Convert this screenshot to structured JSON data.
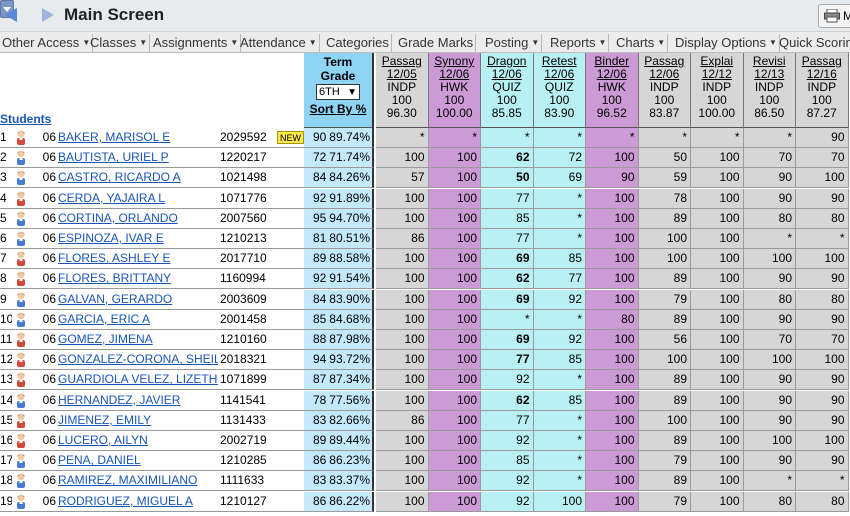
{
  "window": {
    "title": "Main Screen",
    "print_label": "M"
  },
  "menu": [
    {
      "label": "Other Access",
      "caret": true
    },
    {
      "label": "Classes",
      "caret": true
    },
    {
      "label": "Assignments",
      "caret": true
    },
    {
      "label": "Attendance",
      "caret": true
    },
    {
      "label": "Categories",
      "caret": false
    },
    {
      "label": "Grade Marks",
      "caret": false
    },
    {
      "label": "Posting",
      "caret": true
    },
    {
      "label": "Reports",
      "caret": true
    },
    {
      "label": "Charts",
      "caret": true
    },
    {
      "label": "Display Options",
      "caret": true
    },
    {
      "label": "Quick Scoring",
      "caret": false
    }
  ],
  "grid": {
    "students_label": "Students",
    "term_header": {
      "line1": "Term",
      "line2": "Grade",
      "selected_term": "6TH",
      "sort_label": "Sort By %"
    },
    "new_badge": "NEW",
    "assignments": [
      {
        "name": "Passag",
        "date": "12/05",
        "type": "INDP",
        "max": "100",
        "avg": "96.30",
        "color": "#d6d6d6"
      },
      {
        "name": "Synony",
        "date": "12/06",
        "type": "HWK",
        "max": "100",
        "avg": "100.00",
        "color": "#cc9bd6"
      },
      {
        "name": "Dragon",
        "date": "12/06",
        "type": "QUIZ",
        "max": "100",
        "avg": "85.85",
        "color": "#b8f0f3"
      },
      {
        "name": "Retest",
        "date": "12/06",
        "type": "QUIZ",
        "max": "100",
        "avg": "83.90",
        "color": "#b8f0f3"
      },
      {
        "name": "Binder",
        "date": "12/06",
        "type": "HWK",
        "max": "100",
        "avg": "96.52",
        "color": "#cc9bd6"
      },
      {
        "name": "Passag",
        "date": "12/06",
        "type": "INDP",
        "max": "100",
        "avg": "83.87",
        "color": "#d6d6d6"
      },
      {
        "name": "Explai",
        "date": "12/12",
        "type": "INDP",
        "max": "100",
        "avg": "100.00",
        "color": "#d6d6d6"
      },
      {
        "name": "Revisi",
        "date": "12/13",
        "type": "INDP",
        "max": "100",
        "avg": "86.50",
        "color": "#d6d6d6"
      },
      {
        "name": "Passag",
        "date": "12/16",
        "type": "INDP",
        "max": "100",
        "avg": "87.27",
        "color": "#d6d6d6"
      }
    ],
    "students": [
      {
        "num": "1",
        "grade": "06",
        "name": "BAKER, MARISOL E",
        "id": "2029592",
        "new": true,
        "icon": "girl",
        "term": "90",
        "pct": "89.74%",
        "scores": [
          "*",
          "*",
          "*",
          "*",
          "*",
          "*",
          "*",
          "*",
          "90"
        ],
        "bold": []
      },
      {
        "num": "2",
        "grade": "06",
        "name": "BAUTISTA, URIEL P",
        "id": "1220217",
        "new": false,
        "icon": "boy",
        "term": "72",
        "pct": "71.74%",
        "scores": [
          "100",
          "100",
          "62",
          "72",
          "100",
          "50",
          "100",
          "70",
          "70"
        ],
        "bold": [
          2
        ]
      },
      {
        "num": "3",
        "grade": "06",
        "name": "CASTRO, RICARDO A",
        "id": "1021498",
        "new": false,
        "icon": "boy",
        "term": "84",
        "pct": "84.26%",
        "scores": [
          "57",
          "100",
          "50",
          "69",
          "90",
          "59",
          "100",
          "90",
          "100"
        ],
        "bold": [
          2
        ]
      },
      {
        "num": "4",
        "grade": "06",
        "name": "CERDA, YAJAIRA L",
        "id": "1071776",
        "new": false,
        "icon": "girl",
        "term": "92",
        "pct": "91.89%",
        "scores": [
          "100",
          "100",
          "77",
          "*",
          "100",
          "78",
          "100",
          "90",
          "90"
        ],
        "bold": []
      },
      {
        "num": "5",
        "grade": "06",
        "name": "CORTINA, ORLANDO",
        "id": "2007560",
        "new": false,
        "icon": "boy",
        "term": "95",
        "pct": "94.70%",
        "scores": [
          "100",
          "100",
          "85",
          "*",
          "100",
          "89",
          "100",
          "80",
          "80"
        ],
        "bold": []
      },
      {
        "num": "6",
        "grade": "06",
        "name": "ESPINOZA, IVAR E",
        "id": "1210213",
        "new": false,
        "icon": "boy",
        "term": "81",
        "pct": "80.51%",
        "scores": [
          "86",
          "100",
          "77",
          "*",
          "100",
          "100",
          "100",
          "*",
          "*"
        ],
        "bold": []
      },
      {
        "num": "7",
        "grade": "06",
        "name": "FLORES, ASHLEY E",
        "id": "2017710",
        "new": false,
        "icon": "girl",
        "term": "89",
        "pct": "88.58%",
        "scores": [
          "100",
          "100",
          "69",
          "85",
          "100",
          "100",
          "100",
          "100",
          "100"
        ],
        "bold": [
          2
        ]
      },
      {
        "num": "8",
        "grade": "06",
        "name": "FLORES, BRITTANY",
        "id": "1160994",
        "new": false,
        "icon": "girl",
        "term": "92",
        "pct": "91.54%",
        "scores": [
          "100",
          "100",
          "62",
          "77",
          "100",
          "89",
          "100",
          "90",
          "90"
        ],
        "bold": [
          2
        ]
      },
      {
        "num": "9",
        "grade": "06",
        "name": "GALVAN, GERARDO",
        "id": "2003609",
        "new": false,
        "icon": "boy",
        "term": "84",
        "pct": "83.90%",
        "scores": [
          "100",
          "100",
          "69",
          "92",
          "100",
          "79",
          "100",
          "80",
          "80"
        ],
        "bold": [
          2
        ]
      },
      {
        "num": "10",
        "grade": "06",
        "name": "GARCIA, ERIC A",
        "id": "2001458",
        "new": false,
        "icon": "boy",
        "term": "85",
        "pct": "84.68%",
        "scores": [
          "100",
          "100",
          "*",
          "*",
          "80",
          "89",
          "100",
          "90",
          "90"
        ],
        "bold": []
      },
      {
        "num": "11",
        "grade": "06",
        "name": "GOMEZ, JIMENA",
        "id": "1210160",
        "new": false,
        "icon": "girl",
        "term": "88",
        "pct": "87.98%",
        "scores": [
          "100",
          "100",
          "69",
          "92",
          "100",
          "56",
          "100",
          "70",
          "70"
        ],
        "bold": [
          2
        ]
      },
      {
        "num": "12",
        "grade": "06",
        "name": "GONZALEZ-CORONA, SHEILA A",
        "id": "2018321",
        "new": false,
        "icon": "girl",
        "term": "94",
        "pct": "93.72%",
        "scores": [
          "100",
          "100",
          "77",
          "85",
          "100",
          "100",
          "100",
          "100",
          "100"
        ],
        "bold": [
          2
        ]
      },
      {
        "num": "13",
        "grade": "06",
        "name": "GUARDIOLA VELEZ, LIZETH A",
        "id": "1071899",
        "new": false,
        "icon": "girl",
        "term": "87",
        "pct": "87.34%",
        "scores": [
          "100",
          "100",
          "92",
          "*",
          "100",
          "89",
          "100",
          "90",
          "90"
        ],
        "bold": []
      },
      {
        "num": "14",
        "grade": "06",
        "name": "HERNANDEZ, JAVIER",
        "id": "1141541",
        "new": false,
        "icon": "boy",
        "term": "78",
        "pct": "77.56%",
        "scores": [
          "100",
          "100",
          "62",
          "85",
          "100",
          "89",
          "100",
          "90",
          "90"
        ],
        "bold": [
          2
        ]
      },
      {
        "num": "15",
        "grade": "06",
        "name": "JIMENEZ, EMILY",
        "id": "1131433",
        "new": false,
        "icon": "girl",
        "term": "83",
        "pct": "82.66%",
        "scores": [
          "86",
          "100",
          "77",
          "*",
          "100",
          "100",
          "100",
          "90",
          "90"
        ],
        "bold": []
      },
      {
        "num": "16",
        "grade": "06",
        "name": "LUCERO, AILYN",
        "id": "2002719",
        "new": false,
        "icon": "girl",
        "term": "89",
        "pct": "89.44%",
        "scores": [
          "100",
          "100",
          "92",
          "*",
          "100",
          "89",
          "100",
          "100",
          "100"
        ],
        "bold": []
      },
      {
        "num": "17",
        "grade": "06",
        "name": "PENA, DANIEL",
        "id": "1210285",
        "new": false,
        "icon": "boy",
        "term": "86",
        "pct": "86.23%",
        "scores": [
          "100",
          "100",
          "85",
          "*",
          "100",
          "79",
          "100",
          "90",
          "90"
        ],
        "bold": []
      },
      {
        "num": "18",
        "grade": "06",
        "name": "RAMIREZ, MAXIMILIANO",
        "id": "1111633",
        "new": false,
        "icon": "boy",
        "term": "83",
        "pct": "83.37%",
        "scores": [
          "100",
          "100",
          "92",
          "*",
          "100",
          "89",
          "100",
          "*",
          "*"
        ],
        "bold": []
      },
      {
        "num": "19",
        "grade": "06",
        "name": "RODRIGUEZ, MIGUEL A",
        "id": "1210127",
        "new": false,
        "icon": "boy",
        "term": "86",
        "pct": "86.22%",
        "scores": [
          "100",
          "100",
          "92",
          "100",
          "100",
          "79",
          "100",
          "80",
          "80"
        ],
        "bold": []
      }
    ]
  }
}
